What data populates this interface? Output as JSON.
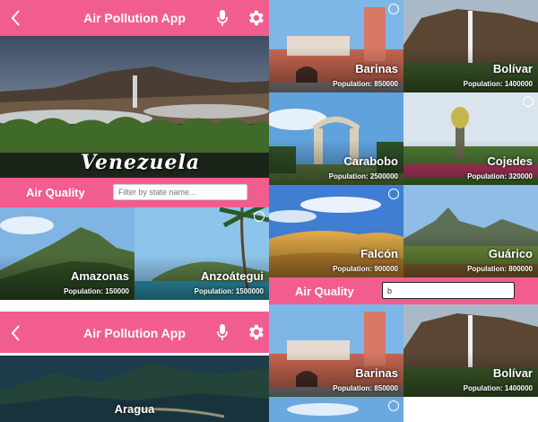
{
  "app": {
    "title": "Air Pollution App"
  },
  "hero": {
    "brand": "Venezuela"
  },
  "filter": {
    "label": "Air Quality",
    "placeholder": "Filter by state name...",
    "value": "",
    "value2": "b"
  },
  "states_left": [
    {
      "name": "Amazonas",
      "population": "Population: 150000"
    },
    {
      "name": "Anzoátegui",
      "population": "Population: 1500000"
    }
  ],
  "aragua": {
    "name": "Aragua"
  },
  "states_right": [
    {
      "name": "Barinas",
      "population": "Population: 850000"
    },
    {
      "name": "Bolívar",
      "population": "Population: 1400000"
    },
    {
      "name": "Carabobo",
      "population": "Population: 2500000"
    },
    {
      "name": "Cojedes",
      "population": "Population: 320000"
    },
    {
      "name": "Falcón",
      "population": "Population: 900000"
    },
    {
      "name": "Guárico",
      "population": "Population: 800000"
    }
  ],
  "states_filtered": [
    {
      "name": "Barinas",
      "population": "Population: 850000"
    },
    {
      "name": "Bolívar",
      "population": "Population: 1400000"
    }
  ],
  "colors": {
    "accent": "#f25d8f"
  },
  "icons": [
    "back-icon",
    "microphone-icon",
    "settings-icon",
    "arrow-circle-icon"
  ]
}
